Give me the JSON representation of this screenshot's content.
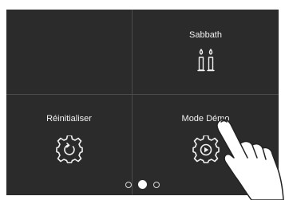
{
  "tiles": {
    "top_left": {
      "label": ""
    },
    "sabbath": {
      "label": "Sabbath",
      "icon": "candles-icon"
    },
    "reset": {
      "label": "Réinitialiser",
      "icon": "gear-reset-icon"
    },
    "demo": {
      "label": "Mode Démo",
      "icon": "gear-play-icon"
    }
  },
  "pager": {
    "pages": 3,
    "active_page": 2
  },
  "colors": {
    "background": "#2b2b2b",
    "divider": "#4a4a4a",
    "text": "#f2f2f2"
  }
}
